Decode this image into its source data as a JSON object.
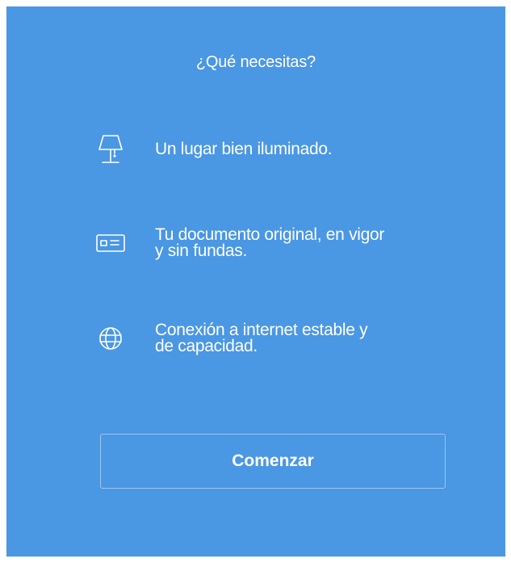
{
  "header": {
    "title": "¿Qué necesitas?"
  },
  "requirements": [
    {
      "icon": "lamp-icon",
      "text_lines": [
        "Un lugar bien iluminado."
      ]
    },
    {
      "icon": "id-card-icon",
      "text_lines": [
        "Tu documento original, en vigor",
        "y sin fundas."
      ]
    },
    {
      "icon": "globe-icon",
      "text_lines": [
        "Conexión a internet estable y",
        "de capacidad."
      ]
    }
  ],
  "actions": {
    "start_label": "Comenzar"
  },
  "colors": {
    "panel_background": "#4a97e3",
    "text": "#ffffff"
  }
}
